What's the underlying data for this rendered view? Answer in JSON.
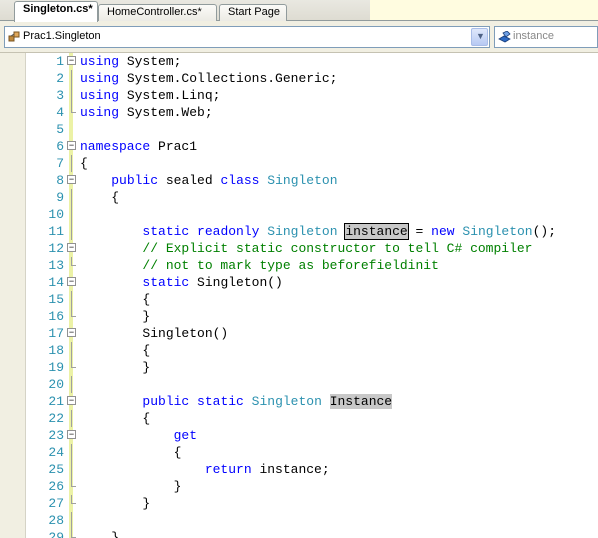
{
  "tabs": [
    {
      "label": "Singleton.cs*",
      "active": true
    },
    {
      "label": "HomeController.cs*",
      "active": false
    },
    {
      "label": "Start Page",
      "active": false
    }
  ],
  "navbar": {
    "type_dropdown": {
      "value": "Prac1.Singleton",
      "icon": "class-icon"
    },
    "member_dropdown": {
      "value": "instance",
      "icon": "field-icon"
    }
  },
  "colors": {
    "keyword": "#0000ff",
    "type": "#2b91af",
    "comment": "#008000",
    "line_number": "#2b91af",
    "highlight": "#c8c8c8",
    "change_bar": "#ecf2a6"
  },
  "lines": [
    {
      "n": "1",
      "fold": "minus",
      "spans": [
        [
          "kw",
          "using"
        ],
        [
          "",
          "System;"
        ]
      ]
    },
    {
      "n": "2",
      "fold": "line",
      "spans": [
        [
          "kw",
          "using"
        ],
        [
          "",
          "System.Collections.Generic;"
        ]
      ]
    },
    {
      "n": "3",
      "fold": "line",
      "spans": [
        [
          "kw",
          "using"
        ],
        [
          "",
          "System.Linq;"
        ]
      ]
    },
    {
      "n": "4",
      "fold": "end",
      "spans": [
        [
          "kw",
          "using"
        ],
        [
          "",
          "System.Web;"
        ]
      ]
    },
    {
      "n": "5",
      "fold": "",
      "spans": []
    },
    {
      "n": "6",
      "fold": "minus",
      "spans": [
        [
          "kw",
          "namespace"
        ],
        [
          "",
          "Prac1"
        ]
      ]
    },
    {
      "n": "7",
      "fold": "line",
      "spans": [
        [
          "",
          "{"
        ]
      ]
    },
    {
      "n": "8",
      "fold": "minus",
      "spans": [
        [
          "",
          "    "
        ],
        [
          "kw",
          "public"
        ],
        [
          "",
          "sealed"
        ],
        [
          "kw",
          "class"
        ],
        [
          "ty",
          "Singleton"
        ]
      ]
    },
    {
      "n": "9",
      "fold": "line",
      "spans": [
        [
          "",
          "    {"
        ]
      ]
    },
    {
      "n": "10",
      "fold": "line",
      "spans": []
    },
    {
      "n": "11",
      "fold": "line",
      "spans": [
        [
          "",
          "        "
        ],
        [
          "kw",
          "static"
        ],
        [
          "kw",
          "readonly"
        ],
        [
          "ty",
          "Singleton"
        ],
        [
          "box",
          "instance"
        ],
        [
          "",
          "="
        ],
        [
          "kw",
          "new"
        ],
        [
          "ty",
          "Singleton"
        ],
        [
          "",
          "();"
        ]
      ]
    },
    {
      "n": "12",
      "fold": "minus",
      "spans": [
        [
          "",
          "        "
        ],
        [
          "cm",
          "// Explicit static constructor to tell C# compiler"
        ]
      ]
    },
    {
      "n": "13",
      "fold": "end",
      "spans": [
        [
          "",
          "        "
        ],
        [
          "cm",
          "// not to mark type as beforefieldinit"
        ]
      ]
    },
    {
      "n": "14",
      "fold": "minus",
      "spans": [
        [
          "",
          "        "
        ],
        [
          "kw",
          "static"
        ],
        [
          "",
          "Singleton()"
        ]
      ]
    },
    {
      "n": "15",
      "fold": "line",
      "spans": [
        [
          "",
          "        {"
        ]
      ]
    },
    {
      "n": "16",
      "fold": "end",
      "spans": [
        [
          "",
          "        }"
        ]
      ]
    },
    {
      "n": "17",
      "fold": "minus",
      "spans": [
        [
          "",
          "        Singleton()"
        ]
      ]
    },
    {
      "n": "18",
      "fold": "line",
      "spans": [
        [
          "",
          "        {"
        ]
      ]
    },
    {
      "n": "19",
      "fold": "end",
      "spans": [
        [
          "",
          "        }"
        ]
      ]
    },
    {
      "n": "20",
      "fold": "line",
      "spans": []
    },
    {
      "n": "21",
      "fold": "minus",
      "spans": [
        [
          "",
          "        "
        ],
        [
          "kw",
          "public"
        ],
        [
          "kw",
          "static"
        ],
        [
          "ty",
          "Singleton"
        ],
        [
          "hl",
          "Instance"
        ]
      ]
    },
    {
      "n": "22",
      "fold": "line",
      "spans": [
        [
          "",
          "        {"
        ]
      ]
    },
    {
      "n": "23",
      "fold": "minus",
      "spans": [
        [
          "",
          "            "
        ],
        [
          "kw",
          "get"
        ]
      ]
    },
    {
      "n": "24",
      "fold": "line",
      "spans": [
        [
          "",
          "            {"
        ]
      ]
    },
    {
      "n": "25",
      "fold": "line",
      "spans": [
        [
          "",
          "                "
        ],
        [
          "kw",
          "return"
        ],
        [
          "",
          "instance;"
        ]
      ]
    },
    {
      "n": "26",
      "fold": "end",
      "spans": [
        [
          "",
          "            }"
        ]
      ]
    },
    {
      "n": "27",
      "fold": "end",
      "spans": [
        [
          "",
          "        }"
        ]
      ]
    },
    {
      "n": "28",
      "fold": "line",
      "spans": []
    },
    {
      "n": "29",
      "fold": "end",
      "spans": [
        [
          "",
          "    }"
        ]
      ]
    }
  ]
}
